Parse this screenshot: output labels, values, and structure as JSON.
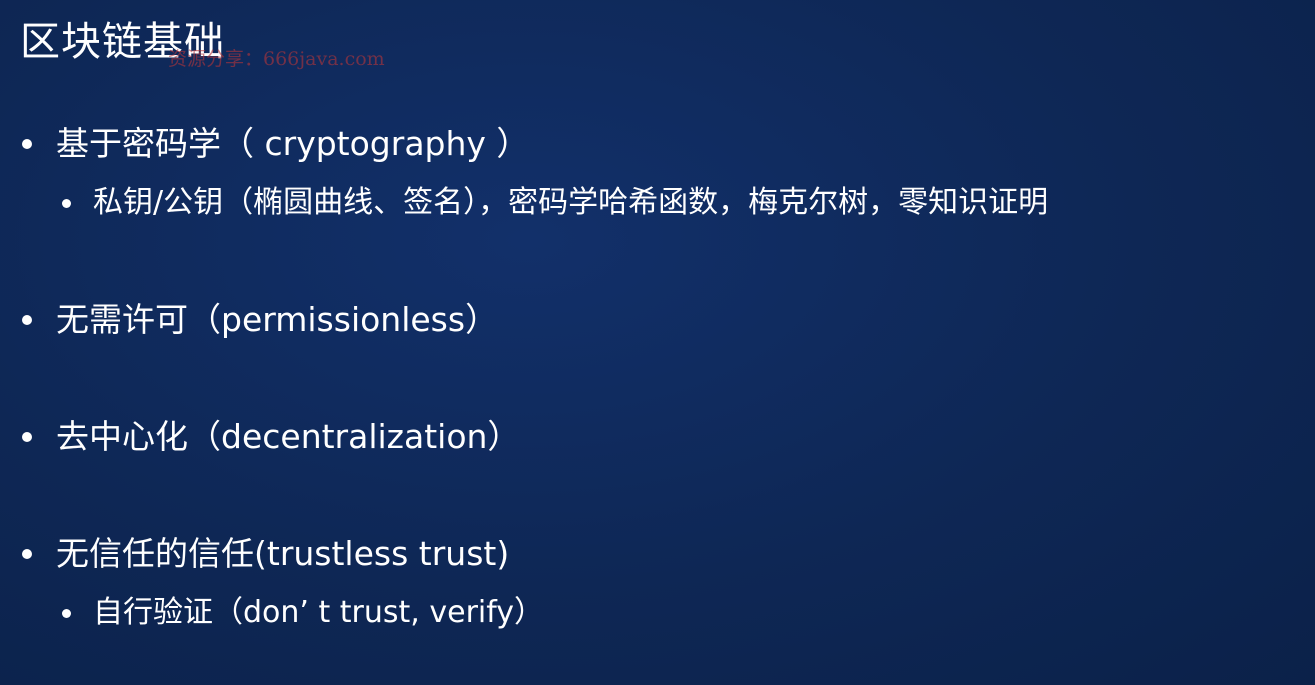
{
  "slide": {
    "title": "区块链基础",
    "watermark": "资源分享：666java.com",
    "bullets": [
      {
        "text": "基于密码学（ cryptography ）",
        "sub": "私钥/公钥（椭圆曲线、签名），密码学哈希函数，梅克尔树，零知识证明"
      },
      {
        "text": "无需许可（permissionless）"
      },
      {
        "text": "去中心化（decentralization）"
      },
      {
        "text": "无信任的信任(trustless trust)",
        "sub": "自行验证（don’ t trust, verify）"
      }
    ]
  }
}
